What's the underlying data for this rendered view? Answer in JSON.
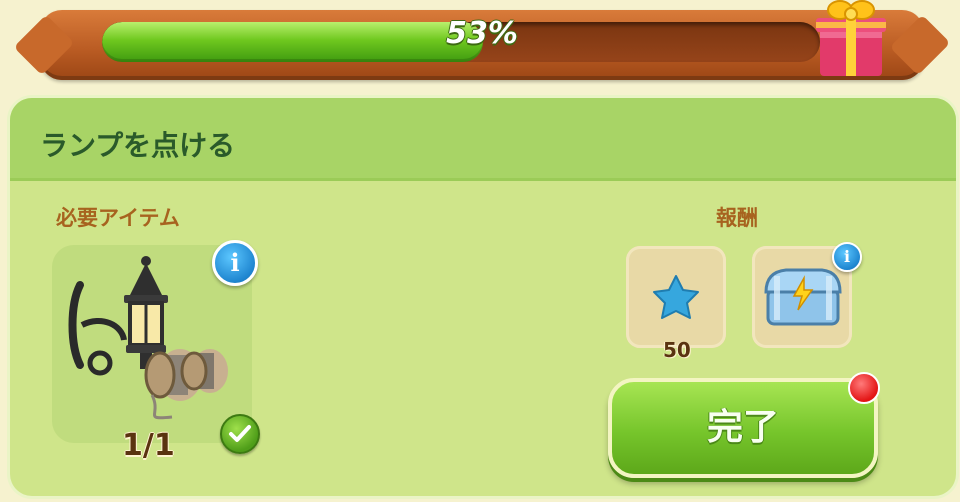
{
  "progress": {
    "percent_label": "53%",
    "fraction": 0.53
  },
  "quest": {
    "title": "ランプを点ける"
  },
  "requirements": {
    "label": "必要アイテム",
    "item_icon": "wall-lantern-and-spools",
    "count": "1/1",
    "completed": true
  },
  "rewards": {
    "label": "報酬",
    "items": [
      {
        "icon": "blue-star-gem",
        "amount": "50"
      },
      {
        "icon": "energy-chest",
        "amount": ""
      }
    ]
  },
  "actions": {
    "complete_label": "完了"
  },
  "colors": {
    "panel": "#cfe58a",
    "header": "#a8d466",
    "accent_green": "#76c52b",
    "bar_brown": "#b85a22"
  }
}
